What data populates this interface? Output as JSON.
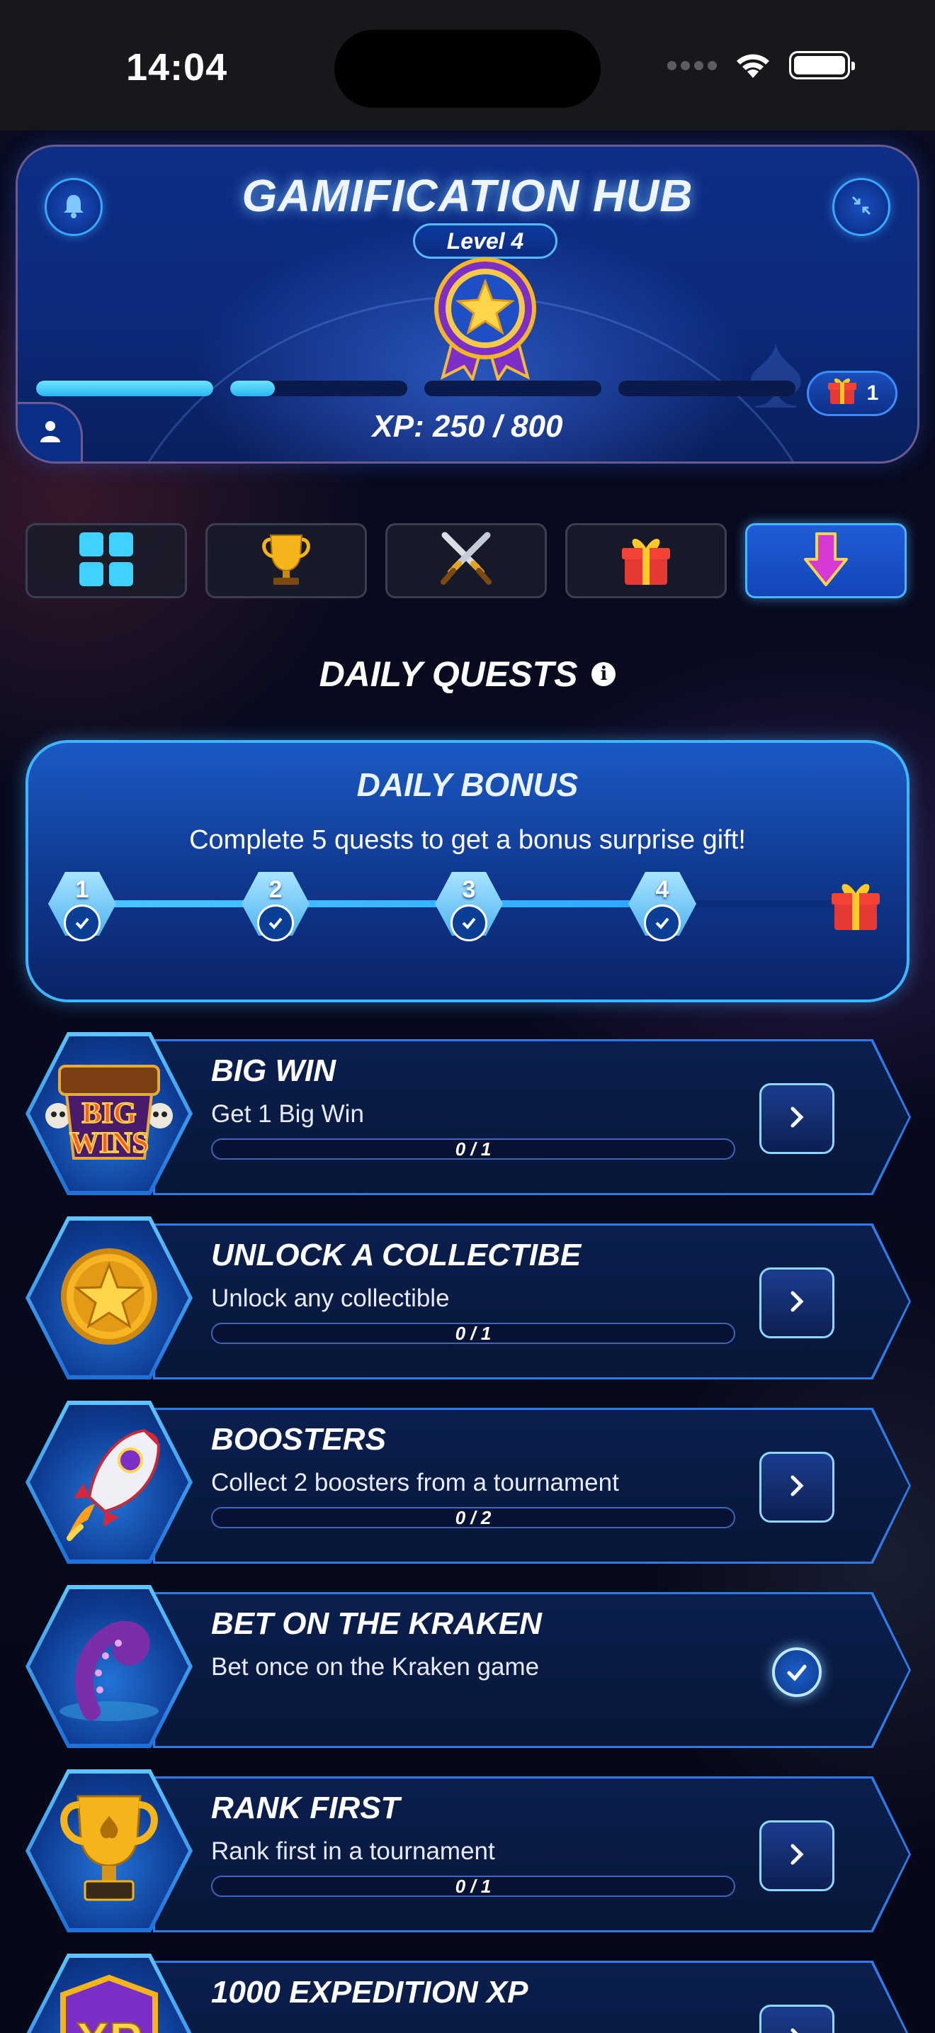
{
  "status_bar": {
    "time": "14:04"
  },
  "hub": {
    "title": "GAMIFICATION HUB",
    "level_label": "Level 4",
    "xp_text": "XP: 250 / 800",
    "gift_count": "1",
    "xp_segments": [
      1.0,
      0.25,
      0,
      0
    ]
  },
  "tabs": [
    {
      "icon": "grid-icon",
      "active": false
    },
    {
      "icon": "trophy-icon",
      "active": false
    },
    {
      "icon": "crossed-swords-icon",
      "active": false
    },
    {
      "icon": "gift-icon",
      "active": false
    },
    {
      "icon": "download-arrow-icon",
      "active": true
    }
  ],
  "section": {
    "title": "DAILY QUESTS"
  },
  "daily_bonus": {
    "title": "DAILY BONUS",
    "description": "Complete 5 quests to get a bonus surprise gift!",
    "steps": [
      "1",
      "2",
      "3",
      "4"
    ],
    "completed_steps": 4
  },
  "quests": [
    {
      "title": "BIG WIN",
      "description": "Get 1 Big Win",
      "progress": "0 / 1",
      "completed": false,
      "icon": "big-wins-icon",
      "badge_text": "BIG WINS"
    },
    {
      "title": "UNLOCK A COLLECTIBE",
      "description": "Unlock any collectible",
      "progress": "0 / 1",
      "completed": false,
      "icon": "gold-star-coin-icon"
    },
    {
      "title": "BOOSTERS",
      "description": "Collect 2 boosters from a tournament",
      "progress": "0 / 2",
      "completed": false,
      "icon": "rocket-icon"
    },
    {
      "title": "BET ON THE KRAKEN",
      "description": "Bet once on the Kraken game",
      "progress": "",
      "completed": true,
      "icon": "kraken-tentacle-icon"
    },
    {
      "title": "RANK FIRST",
      "description": "Rank first in a tournament",
      "progress": "0 / 1",
      "completed": false,
      "icon": "gold-trophy-icon"
    },
    {
      "title": "1000 EXPEDITION XP",
      "description": "",
      "progress": "",
      "completed": false,
      "icon": "xp-shield-icon",
      "badge_text": "XP"
    }
  ],
  "colors": {
    "accent": "#3fb4ff",
    "hub_blue": "#0d2e86",
    "background": "#05081a"
  }
}
